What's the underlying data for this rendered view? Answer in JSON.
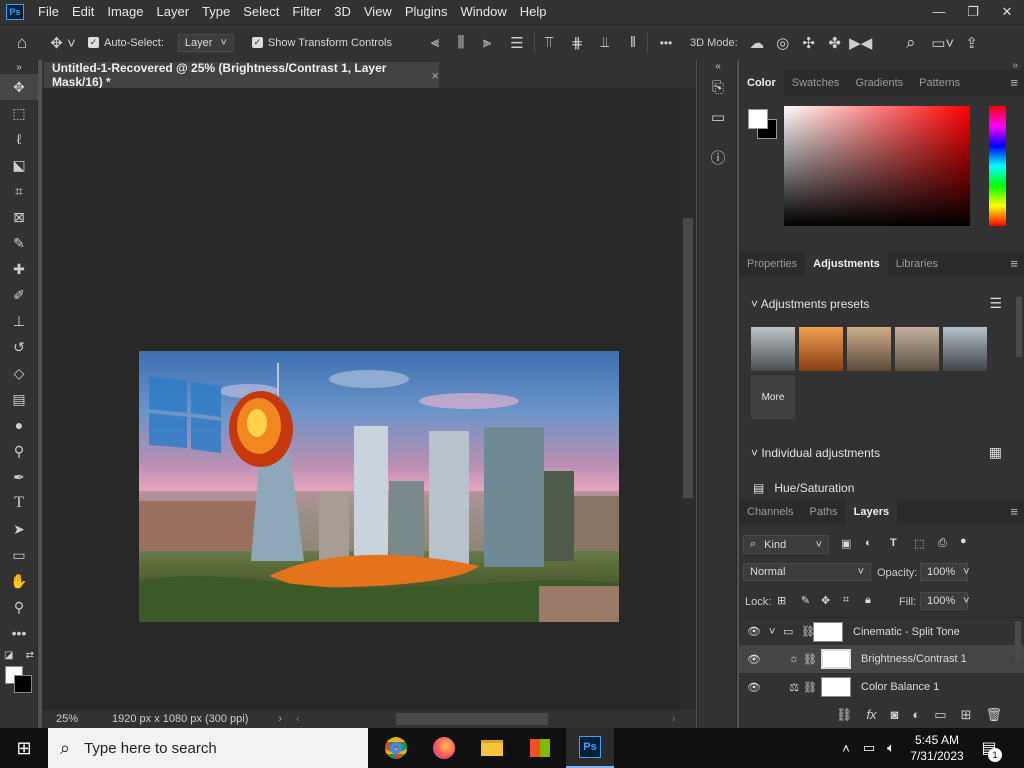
{
  "menubar": {
    "logo": "Ps",
    "items": [
      "File",
      "Edit",
      "Image",
      "Layer",
      "Type",
      "Select",
      "Filter",
      "3D",
      "View",
      "Plugins",
      "Window",
      "Help"
    ],
    "controls": [
      "—",
      "❐",
      "✕"
    ]
  },
  "options": {
    "auto_select_label": "Auto-Select:",
    "auto_select_value": "Layer",
    "transform_label": "Show Transform Controls",
    "mode_3d_label": "3D Mode:",
    "more": "•••"
  },
  "document": {
    "tab_title": "Untitled-1-Recovered @ 25% (Brightness/Contrast 1, Layer Mask/16) *",
    "close": "×",
    "zoom": "25%",
    "doc_info": "1920 px x 1080 px (300 ppi)"
  },
  "color_panel": {
    "tabs": [
      "Color",
      "Swatches",
      "Gradients",
      "Patterns"
    ],
    "active_tab": "Color",
    "hue_color": "#ff0000"
  },
  "props_panel": {
    "tabs": [
      "Properties",
      "Adjustments",
      "Libraries"
    ],
    "active_tab": "Adjustments",
    "presets_label": "Adjustments presets",
    "more_label": "More",
    "individual_label": "Individual adjustments",
    "hue_sat_label": "Hue/Saturation"
  },
  "layers_panel": {
    "tabs": [
      "Channels",
      "Paths",
      "Layers"
    ],
    "active_tab": "Layers",
    "kind_label": "Kind",
    "blend_mode": "Normal",
    "opacity_label": "Opacity:",
    "opacity_value": "100%",
    "lock_label": "Lock:",
    "fill_label": "Fill:",
    "fill_value": "100%",
    "layers": [
      {
        "name": "Cinematic - Split Tone",
        "type": "group"
      },
      {
        "name": "Brightness/Contrast 1",
        "type": "adjustment",
        "selected": true
      },
      {
        "name": "Color Balance 1",
        "type": "adjustment"
      }
    ]
  },
  "taskbar": {
    "search_placeholder": "Type here to search",
    "time": "5:45 AM",
    "date": "7/31/2023",
    "notification_count": "1",
    "ps_label": "Ps"
  }
}
